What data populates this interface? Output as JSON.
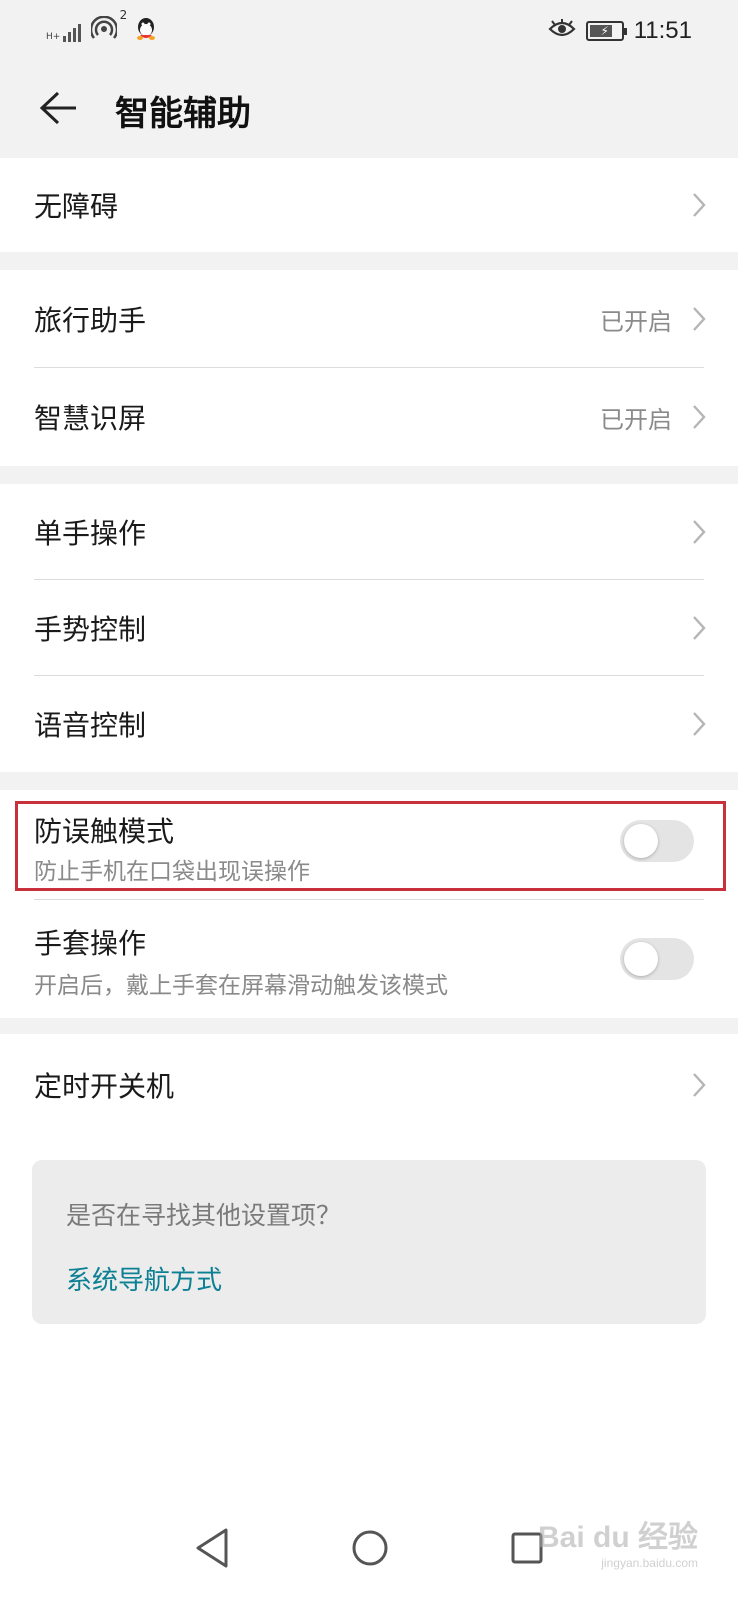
{
  "status_bar": {
    "network_label": "H+",
    "hotspot_count": "2",
    "time": "11:51"
  },
  "header": {
    "title": "智能辅助"
  },
  "group1": {
    "items": [
      {
        "label": "无障碍",
        "value": ""
      }
    ]
  },
  "group2": {
    "items": [
      {
        "label": "旅行助手",
        "value": "已开启"
      },
      {
        "label": "智慧识屏",
        "value": "已开启"
      }
    ]
  },
  "group3": {
    "items": [
      {
        "label": "单手操作",
        "value": ""
      },
      {
        "label": "手势控制",
        "value": ""
      },
      {
        "label": "语音控制",
        "value": ""
      }
    ]
  },
  "group4": {
    "items": [
      {
        "label": "防误触模式",
        "sub": "防止手机在口袋出现误操作",
        "enabled": false
      },
      {
        "label": "手套操作",
        "sub": "开启后，戴上手套在屏幕滑动触发该模式",
        "enabled": false
      }
    ]
  },
  "group5": {
    "items": [
      {
        "label": "定时开关机",
        "value": ""
      }
    ]
  },
  "suggestion": {
    "question": "是否在寻找其他设置项？",
    "link": "系统导航方式"
  },
  "watermark": {
    "brand": "Bai du 经验",
    "url": "jingyan.baidu.com"
  },
  "colors": {
    "accent_link": "#0b7f93",
    "highlight_border": "#c8313b"
  }
}
